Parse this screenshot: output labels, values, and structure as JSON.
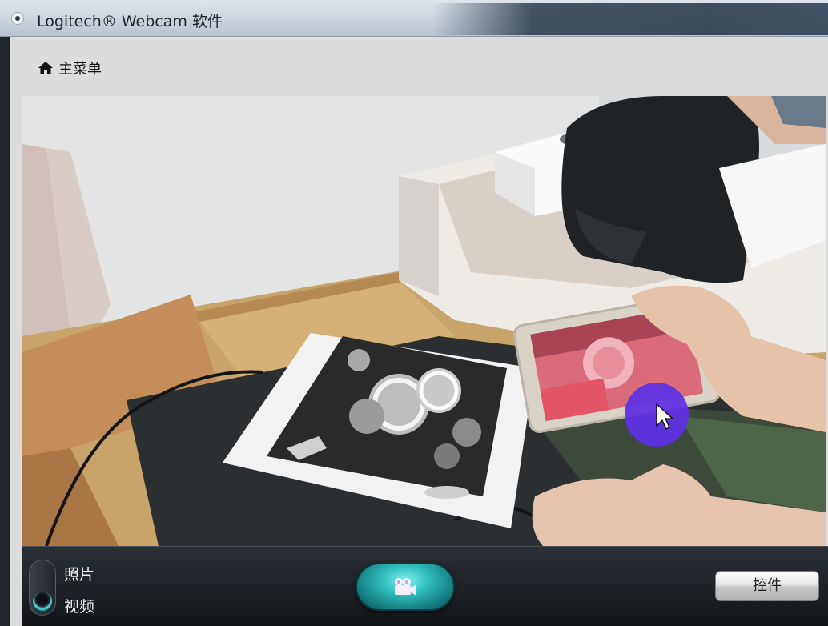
{
  "window": {
    "title": "Logitech® Webcam 软件"
  },
  "nav": {
    "main_menu_label": "主菜单",
    "main_menu_icon": "home-icon"
  },
  "preview": {
    "description_icon": "camera-feed"
  },
  "controlbar": {
    "mode_photo_label": "照片",
    "mode_video_label": "视频",
    "selected_mode": "视频",
    "record_icon": "video-camera-icon",
    "controls_button_label": "控件"
  },
  "colors": {
    "accent": "#2fbcbd",
    "titlebar": "#c9d2dc",
    "window_bg": "#dcdcdc",
    "controlbar": "#1b1f24"
  }
}
